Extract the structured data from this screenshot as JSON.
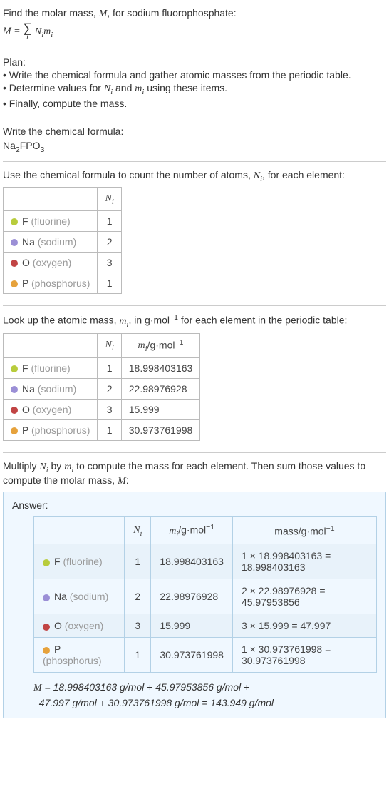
{
  "intro": {
    "line1": "Find the molar mass, ",
    "line1_var": "M",
    "line1_end": ", for sodium fluorophosphate:",
    "formula_lhs": "M",
    "formula_eq": " = ",
    "sum_top": "",
    "sum_sym": "∑",
    "sum_idx": "i",
    "formula_rhs_a": "N",
    "formula_rhs_b": "m"
  },
  "plan": {
    "title": "Plan:",
    "bullets": [
      "• Write the chemical formula and gather atomic masses from the periodic table.",
      "• Determine values for Nᵢ and mᵢ using these items.",
      "• Finally, compute the mass."
    ]
  },
  "step1": {
    "title": "Write the chemical formula:",
    "formula_text": "Na₂FPO₃"
  },
  "step2": {
    "title_a": "Use the chemical formula to count the number of atoms, ",
    "title_var": "N",
    "title_b": ", for each element:",
    "header_col2": "Nᵢ",
    "rows": [
      {
        "color": "#b8cc3c",
        "sym": "F",
        "name": "(fluorine)",
        "n": "1"
      },
      {
        "color": "#9b8fd6",
        "sym": "Na",
        "name": "(sodium)",
        "n": "2"
      },
      {
        "color": "#c14444",
        "sym": "O",
        "name": "(oxygen)",
        "n": "3"
      },
      {
        "color": "#e6a23c",
        "sym": "P",
        "name": "(phosphorus)",
        "n": "1"
      }
    ]
  },
  "step3": {
    "title_a": "Look up the atomic mass, ",
    "title_var": "m",
    "title_b": ", in g·mol",
    "title_c": " for each element in the periodic table:",
    "header_col2": "Nᵢ",
    "header_col3": "mᵢ/g·mol⁻¹",
    "rows": [
      {
        "color": "#b8cc3c",
        "sym": "F",
        "name": "(fluorine)",
        "n": "1",
        "m": "18.998403163"
      },
      {
        "color": "#9b8fd6",
        "sym": "Na",
        "name": "(sodium)",
        "n": "2",
        "m": "22.98976928"
      },
      {
        "color": "#c14444",
        "sym": "O",
        "name": "(oxygen)",
        "n": "3",
        "m": "15.999"
      },
      {
        "color": "#e6a23c",
        "sym": "P",
        "name": "(phosphorus)",
        "n": "1",
        "m": "30.973761998"
      }
    ]
  },
  "step4": {
    "title_a": "Multiply ",
    "title_b": " by ",
    "title_c": " to compute the mass for each element. Then sum those values to compute the molar mass, ",
    "title_d": ":"
  },
  "answer": {
    "label": "Answer:",
    "header_col2": "Nᵢ",
    "header_col3": "mᵢ/g·mol⁻¹",
    "header_col4": "mass/g·mol⁻¹",
    "rows": [
      {
        "color": "#b8cc3c",
        "sym": "F",
        "name": "(fluorine)",
        "n": "1",
        "m": "18.998403163",
        "mass": "1 × 18.998403163 = 18.998403163"
      },
      {
        "color": "#9b8fd6",
        "sym": "Na",
        "name": "(sodium)",
        "n": "2",
        "m": "22.98976928",
        "mass": "2 × 22.98976928 = 45.97953856"
      },
      {
        "color": "#c14444",
        "sym": "O",
        "name": "(oxygen)",
        "n": "3",
        "m": "15.999",
        "mass": "3 × 15.999 = 47.997"
      },
      {
        "color": "#e6a23c",
        "sym": "P",
        "name": "(phosphorus)",
        "n": "1",
        "m": "30.973761998",
        "mass": "1 × 30.973761998 = 30.973761998"
      }
    ],
    "final_line1": "M = 18.998403163 g/mol + 45.97953856 g/mol + ",
    "final_line2": "47.997 g/mol + 30.973761998 g/mol = 143.949 g/mol"
  },
  "chart_data": {
    "type": "table",
    "title": "Molar mass of sodium fluorophosphate Na2FPO3",
    "columns": [
      "element",
      "N_i",
      "m_i_g_per_mol",
      "mass_g_per_mol"
    ],
    "rows": [
      [
        "F (fluorine)",
        1,
        18.998403163,
        18.998403163
      ],
      [
        "Na (sodium)",
        2,
        22.98976928,
        45.97953856
      ],
      [
        "O (oxygen)",
        3,
        15.999,
        47.997
      ],
      [
        "P (phosphorus)",
        1,
        30.973761998,
        30.973761998
      ]
    ],
    "total_molar_mass_g_per_mol": 143.949
  }
}
